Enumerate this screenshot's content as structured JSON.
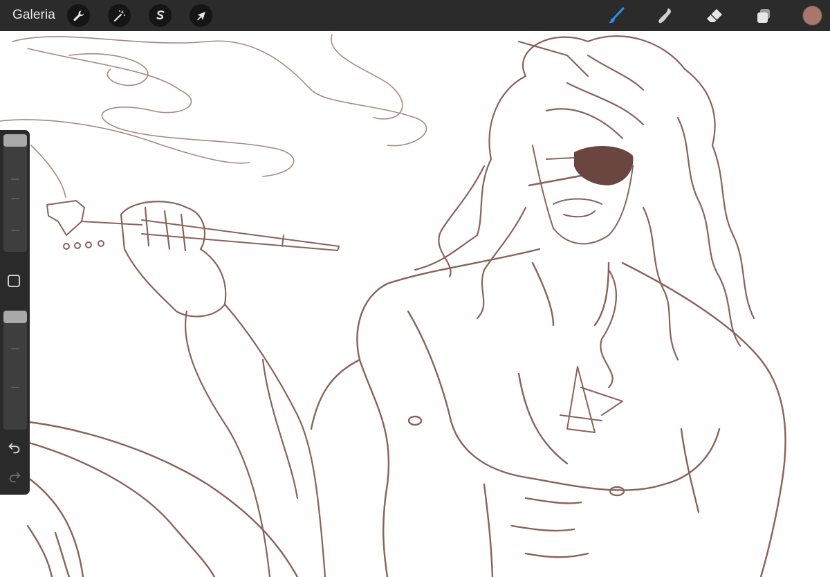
{
  "topbar": {
    "gallery_label": "Galeria",
    "left_tools": [
      {
        "name": "actions",
        "icon": "wrench-icon"
      },
      {
        "name": "adjustments",
        "icon": "magic-wand-icon"
      },
      {
        "name": "selection",
        "icon": "selection-s-icon"
      },
      {
        "name": "transform",
        "icon": "arrow-cursor-icon"
      }
    ],
    "right_tools": [
      {
        "name": "brush",
        "icon": "brush-icon",
        "active": true
      },
      {
        "name": "smudge",
        "icon": "smudge-finger-icon",
        "active": false
      },
      {
        "name": "eraser",
        "icon": "eraser-icon",
        "active": false
      },
      {
        "name": "layers",
        "icon": "layers-icon",
        "active": false
      }
    ],
    "current_color": "#a9766a"
  },
  "sidebar": {
    "brush_size_slider": {
      "icon": "slider-thumb"
    },
    "modifier_button": {
      "icon": "square-outline-icon"
    },
    "opacity_slider": {
      "icon": "slider-thumb"
    },
    "undo": {
      "icon": "undo-arrow-icon"
    },
    "redo": {
      "icon": "redo-arrow-icon"
    }
  },
  "colors": {
    "bar_background": "#2b2b2b",
    "active_tool_blue": "#2b8ef7",
    "sketch_stroke": "#7a5248",
    "eyepatch_fill": "#6b4540"
  }
}
